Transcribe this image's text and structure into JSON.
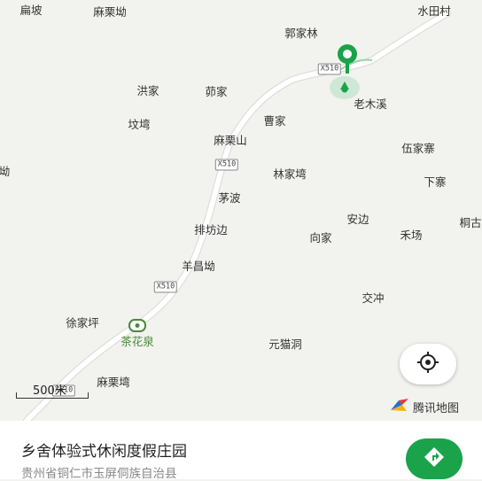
{
  "map": {
    "places": [
      {
        "name": "扁坡"
      },
      {
        "name": "麻栗坳"
      },
      {
        "name": "水田村"
      },
      {
        "name": "郭家林"
      },
      {
        "name": "洪家"
      },
      {
        "name": "茆家"
      },
      {
        "name": "老木溪"
      },
      {
        "name": "坟塆"
      },
      {
        "name": "曹家"
      },
      {
        "name": "麻栗山"
      },
      {
        "name": "伍家寨"
      },
      {
        "name": "坳"
      },
      {
        "name": "林家塆"
      },
      {
        "name": "下寨"
      },
      {
        "name": "茅波"
      },
      {
        "name": "安边"
      },
      {
        "name": "桐古"
      },
      {
        "name": "排坊边"
      },
      {
        "name": "向家"
      },
      {
        "name": "禾场"
      },
      {
        "name": "羊昌坳"
      },
      {
        "name": "交冲"
      },
      {
        "name": "徐家坪"
      },
      {
        "name": "茶花泉"
      },
      {
        "name": "元猫洞"
      },
      {
        "name": "麻栗塆"
      }
    ],
    "road_shields": [
      "X510",
      "X510",
      "X510",
      "X510"
    ],
    "scale_label": "500米",
    "brand_label": "腾讯地图"
  },
  "place_card": {
    "title": "乡舍体验式休闲度假庄园",
    "address": "贵州省铜仁市玉屏侗族自治县"
  },
  "icons": {
    "locate": "crosshair-icon",
    "navigate": "navigate-icon",
    "destination": "map-pin-icon",
    "current": "location-dot-icon",
    "poi": "poi-icon",
    "brand": "tencent-maps-logo-icon"
  },
  "colors": {
    "map_bg": "#f2f2ef",
    "road": "#ffffff",
    "accent_green": "#1aa34a",
    "poi_green": "#4a8a3a"
  }
}
